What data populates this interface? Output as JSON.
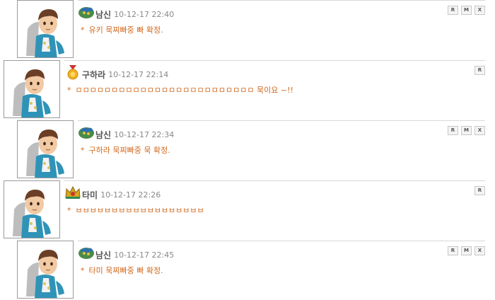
{
  "buttons": {
    "reply": "R",
    "modify": "M",
    "delete": "X"
  },
  "comments": [
    {
      "name": "남신",
      "timestamp": "10-12-17 22:40",
      "star": "*",
      "text": "유키 묵찌빠중 빠 확정.",
      "badge_icon": "dragon-emblem-icon",
      "avatar_icon": "character-avatar-icon"
    },
    {
      "name": "구하라",
      "timestamp": "10-12-17 22:14",
      "star": "*",
      "text": "ㅁㅁㅁㅁㅁㅁㅁㅁㅁㅁㅁㅁㅁㅁㅁㅁㅁㅁㅁㅁㅁㅁㅁㅁㅁ 묵이요 ~!!",
      "badge_icon": "gold-medal-icon",
      "avatar_icon": "character-avatar-icon"
    },
    {
      "name": "남신",
      "timestamp": "10-12-17 22:34",
      "star": "*",
      "text": "구하라 묵찌빠중 묵 확정.",
      "badge_icon": "dragon-emblem-icon",
      "avatar_icon": "character-avatar-icon"
    },
    {
      "name": "타미",
      "timestamp": "10-12-17 22:26",
      "star": "*",
      "text": "ㅂㅂㅂㅂㅂㅂㅂㅂㅂㅂㅂㅂㅂㅂㅂㅂㅂㅂ",
      "badge_icon": "crown-emblem-icon",
      "avatar_icon": "character-avatar-icon"
    },
    {
      "name": "남신",
      "timestamp": "10-12-17 22:45",
      "star": "*",
      "text": "타미 묵찌빠중 빠 확정.",
      "badge_icon": "dragon-emblem-icon",
      "avatar_icon": "character-avatar-icon"
    }
  ]
}
